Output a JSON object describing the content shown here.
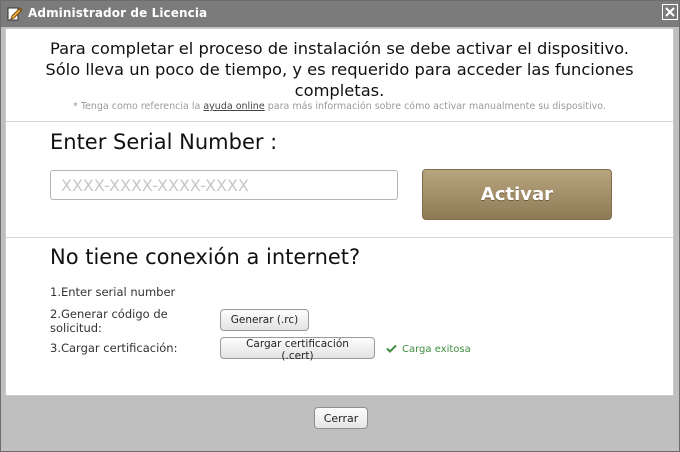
{
  "window": {
    "title": "Administrador de Licencia",
    "title_icon": "edit-icon",
    "close_icon": "close-icon"
  },
  "intro": {
    "line1": "Para completar el proceso de instalación se debe activar el dispositivo.",
    "line2": "Sólo lleva un poco de tiempo, y es requerido para acceder las funciones",
    "line3": "completas.",
    "note_prefix": "* Tenga como referencia la",
    "note_link": "ayuda online",
    "note_suffix": "para más información sobre cómo activar manualmente su dispositivo."
  },
  "serial": {
    "title": "Enter Serial Number :",
    "placeholder": "XXXX-XXXX-XXXX-XXXX",
    "value": "",
    "activate_label": "Activar"
  },
  "offline": {
    "title": "No tiene conexión a internet?",
    "step1": "1.Enter serial number",
    "step2": "2.Generar código de solicitud:",
    "step3": "3.Cargar certificación:",
    "generate_button": "Generar (.rc)",
    "load_button": "Cargar certificación (.cert)",
    "status": "Carga exitosa",
    "status_icon": "check-icon"
  },
  "footer": {
    "close_button": "Cerrar"
  },
  "colors": {
    "titlebar": "#7b7b7b",
    "activate_button": "#a18d66",
    "success": "#3f8f3f"
  }
}
